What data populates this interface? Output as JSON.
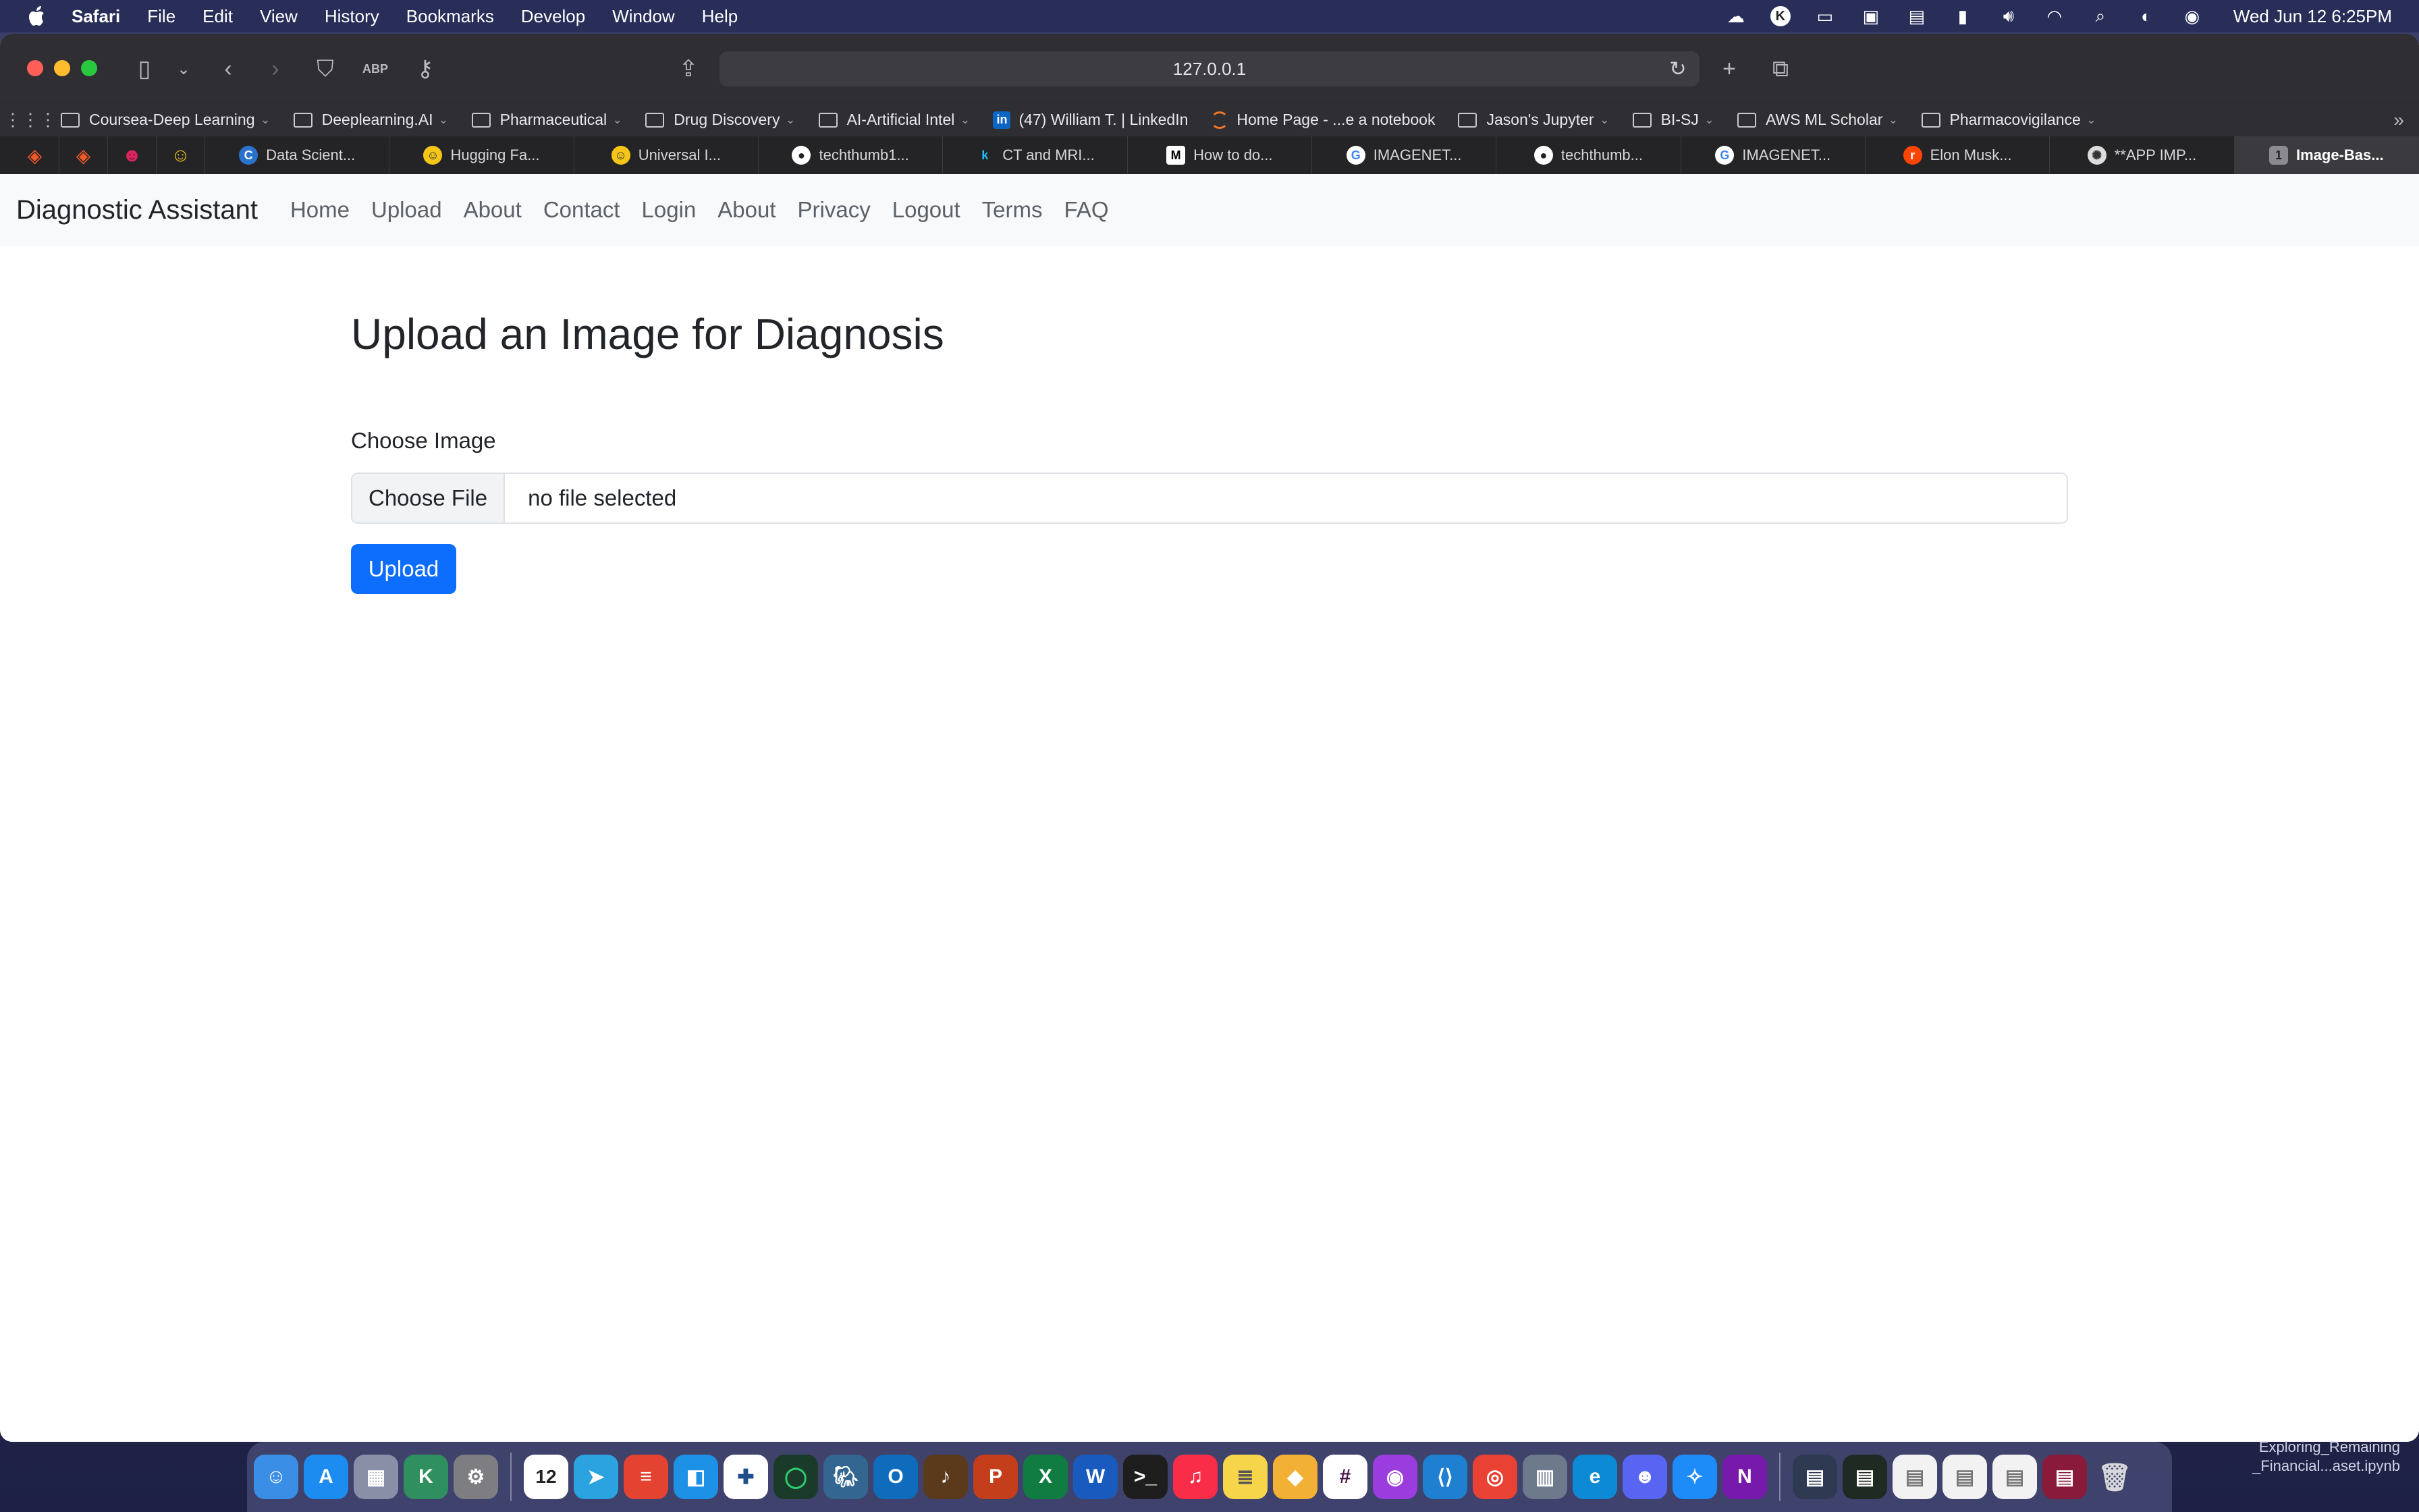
{
  "menubar": {
    "items": [
      "Safari",
      "File",
      "Edit",
      "View",
      "History",
      "Bookmarks",
      "Develop",
      "Window",
      "Help"
    ],
    "clock": "Wed Jun 12  6:25PM"
  },
  "browser": {
    "url": "127.0.0.1",
    "bookmarks": [
      {
        "label": "Coursea-Deep Learning",
        "type": "folder"
      },
      {
        "label": "Deeplearning.AI",
        "type": "folder"
      },
      {
        "label": "Pharmaceutical",
        "type": "folder"
      },
      {
        "label": "Drug Discovery",
        "type": "folder"
      },
      {
        "label": "AI-Artificial Intel",
        "type": "folder"
      },
      {
        "label": "(47) William T. | LinkedIn",
        "type": "linkedin"
      },
      {
        "label": "Home Page - ...e a notebook",
        "type": "jupyter"
      },
      {
        "label": "Jason's Jupyter",
        "type": "folder"
      },
      {
        "label": "BI-SJ",
        "type": "folder"
      },
      {
        "label": "AWS ML Scholar",
        "type": "folder"
      },
      {
        "label": "Pharmacovigilance",
        "type": "folder"
      }
    ],
    "tabs": [
      {
        "label": "Data Scient...",
        "favicon": "C",
        "color": "#2a73cc"
      },
      {
        "label": "Hugging Fa...",
        "favicon": "☺",
        "color": "#f5c518"
      },
      {
        "label": "Universal I...",
        "favicon": "☺",
        "color": "#f5c518"
      },
      {
        "label": "techthumb1...",
        "favicon": "●",
        "color": "#444"
      },
      {
        "label": "CT and MRI...",
        "favicon": "k",
        "color": "#20beff"
      },
      {
        "label": "How to do...",
        "favicon": "M",
        "color": "#000"
      },
      {
        "label": "IMAGENET...",
        "favicon": "G",
        "color": "#4285f4"
      },
      {
        "label": "techthumb...",
        "favicon": "●",
        "color": "#444"
      },
      {
        "label": "IMAGENET...",
        "favicon": "G",
        "color": "#4285f4"
      },
      {
        "label": "Elon Musk...",
        "favicon": "r",
        "color": "#ff4500"
      },
      {
        "label": "**APP IMP...",
        "favicon": "✺",
        "color": "#555"
      },
      {
        "label": "Image-Bas...",
        "favicon": "1",
        "color": "#8a8a90",
        "active": true
      }
    ]
  },
  "app": {
    "brand": "Diagnostic Assistant",
    "nav": [
      "Home",
      "Upload",
      "About",
      "Contact",
      "Login",
      "About",
      "Privacy",
      "Logout",
      "Terms",
      "FAQ"
    ],
    "title": "Upload an Image for Diagnosis",
    "field_label": "Choose Image",
    "file_button": "Choose File",
    "file_status": "no file selected",
    "submit_label": "Upload",
    "colors": {
      "primary": "#0d6efd",
      "navbar_bg": "#f8f9fa"
    }
  },
  "desktop": {
    "label_line1": "Exploring_Remaining",
    "label_line2": "_Financial...aset.ipynb"
  }
}
